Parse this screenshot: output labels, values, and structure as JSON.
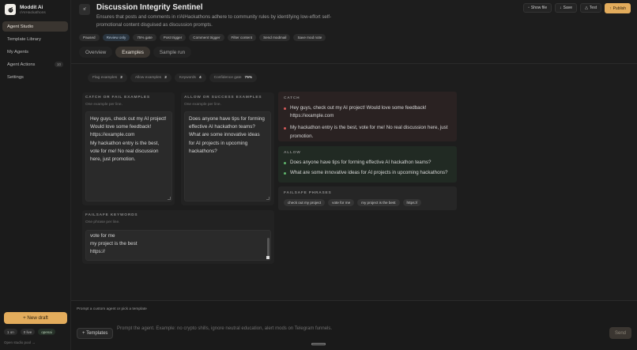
{
  "brand": {
    "name": "Moddit Ai",
    "subtitle": "r/AIHackathons"
  },
  "sidebar": {
    "items": [
      {
        "label": "Agent Studio",
        "active": true
      },
      {
        "label": "Template Library"
      },
      {
        "label": "My Agents"
      },
      {
        "label": "Agent Actions",
        "count": "10"
      },
      {
        "label": "Settings"
      }
    ],
    "new_draft": "+ New draft",
    "status": [
      "1 on",
      "0 live",
      "openai"
    ],
    "footer_link": "Open studio pool →"
  },
  "header": {
    "icon_text": "r/",
    "title": "Discussion Integrity Sentinel",
    "description": "Ensures that posts and comments in r/AIHackathons adhere to community rules by identifying low-effort self-promotional content disguised as discussion prompts.",
    "actions": {
      "show_file": "Show file",
      "save": "Save",
      "test": "Test",
      "publish": "Publish"
    },
    "tags": [
      "Paused",
      "Review only",
      "75% gate",
      "Post trigger",
      "Comment trigger",
      "Filter content",
      "Send modmail",
      "Save mod note"
    ],
    "tabs": [
      "Overview",
      "Examples",
      "Sample run"
    ]
  },
  "stats": [
    {
      "label": "Flag examples",
      "value": "2"
    },
    {
      "label": "Allow examples",
      "value": "2"
    },
    {
      "label": "Keywords",
      "value": "4"
    },
    {
      "label": "Confidence gate",
      "value": "75%"
    }
  ],
  "catch_card": {
    "label": "CATCH OR FAIL EXAMPLES",
    "sub": "One example per line.",
    "lines": [
      "Hey guys, check out my AI project!",
      "Would love some feedback!",
      "https://example.com",
      "My hackathon entry is the best,",
      "vote for me! No real discussion",
      "here, just promotion."
    ]
  },
  "allow_card": {
    "label": "ALLOW OR SUCCESS EXAMPLES",
    "sub": "One example per line.",
    "lines": [
      "Does anyone have tips for forming",
      "effective AI hackathon teams?",
      "What are some innovative ideas",
      "for AI projects in upcoming",
      "hackathons?"
    ]
  },
  "keywords_card": {
    "label": "FAILSAFE KEYWORDS",
    "sub": "One phrase per line.",
    "lines": [
      "vote for me",
      "my project is the best",
      "https://"
    ]
  },
  "preview": {
    "catch_label": "CATCH",
    "catch_items": [
      "Hey guys, check out my AI project! Would love some feedback! https://example.com",
      "My hackathon entry is the best, vote for me! No real discussion here, just promotion."
    ],
    "allow_label": "ALLOW",
    "allow_items": [
      "Does anyone have tips for forming effective AI hackathon teams?",
      "What are some innovative ideas for AI projects in upcoming hackathons?"
    ],
    "phrases_label": "FAILSAFE PHRASES",
    "phrases": [
      "check out my project",
      "vote for me",
      "my project is the best",
      "https://"
    ]
  },
  "composer": {
    "hint": "Prompt a custom agent or pick a template",
    "templates": "+ Templates",
    "placeholder": "Prompt the agent. Example: no crypto shills, ignore neutral education, alert mods on Telegram funnels.",
    "send": "Send"
  },
  "colors": {
    "accent": "#e3ac5c",
    "catch_dot": "#d65a5a",
    "allow_dot": "#5fb56c"
  }
}
